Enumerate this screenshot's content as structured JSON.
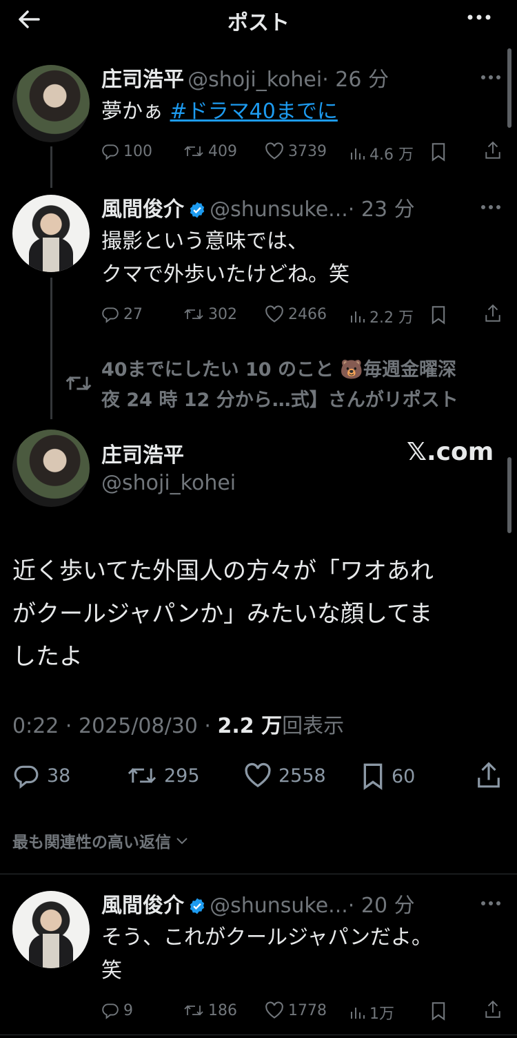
{
  "header": {
    "title": "ポスト"
  },
  "tweet1": {
    "name": "庄司浩平",
    "handle": "@shoji_kohei",
    "time": "· 26 分",
    "text": "夢かぁ ",
    "hashtag": "#ドラマ40までに",
    "replies": "100",
    "reposts": "409",
    "likes": "3739",
    "views": "4.6 万"
  },
  "tweet2": {
    "name": "風間俊介",
    "handle": "@shunsuke...",
    "time": "· 23 分",
    "line1": "撮影という意味では、",
    "line2": "クマで外歩いたけどね。笑",
    "replies": "27",
    "reposts": "302",
    "likes": "2466",
    "views": "2.2 万"
  },
  "repost_notice": {
    "line1": "40までにしたい 10 のこと 🐻毎週金曜深",
    "line2": "夜 24 時 12 分から…式】さんがリポスト"
  },
  "main_post": {
    "name": "庄司浩平",
    "handle": "@shoji_kohei",
    "source": "𝕏.com",
    "line1": "近く歩いてた外国人の方々が「ワオあれ",
    "line2": "がクールジャパンか」みたいな顔してま",
    "line3": "したよ",
    "timestamp": "0:22 · 2025/08/30 · ",
    "views_count": "2.2 万",
    "views_label": "回表示",
    "replies": "38",
    "reposts": "295",
    "likes": "2558",
    "bookmarks": "60"
  },
  "replies_sort": {
    "label": "最も関連性の高い返信"
  },
  "reply1": {
    "name": "風間俊介",
    "handle": "@shunsuke...",
    "time": "· 20 分",
    "line1": "そう、これがクールジャパンだよ。",
    "line2": "笑",
    "replies": "9",
    "reposts": "186",
    "likes": "1778",
    "views": "1万"
  },
  "colors": {
    "background": "#000000",
    "text": "#e7e9ea",
    "muted": "#71767b",
    "link": "#1d9bf0",
    "verified": "#1d9bf0"
  }
}
